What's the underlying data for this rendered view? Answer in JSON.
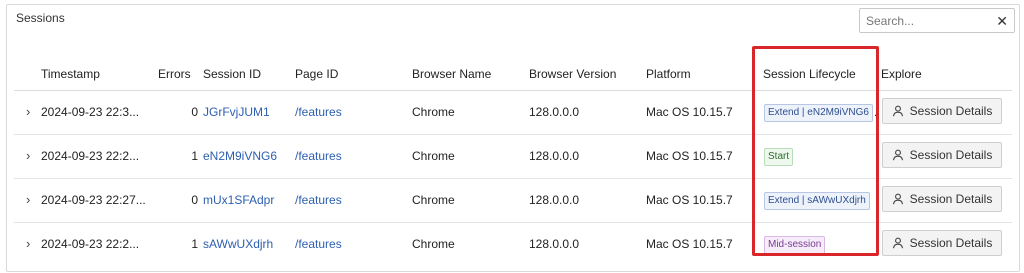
{
  "panel": {
    "title": "Sessions"
  },
  "search": {
    "placeholder": "Search...",
    "clear": "✕"
  },
  "columns": {
    "timestamp": "Timestamp",
    "errors": "Errors",
    "session_id": "Session ID",
    "page_id": "Page ID",
    "browser_name": "Browser Name",
    "browser_version": "Browser Version",
    "platform": "Platform",
    "session_lifecycle": "Session Lifecycle",
    "explore": "Explore"
  },
  "rows": [
    {
      "expand": "›",
      "timestamp": "2024-09-23 22:3...",
      "errors": "0",
      "session_id": "JGrFvjJUM1",
      "page_id": "/features",
      "browser_name": "Chrome",
      "browser_version": "128.0.0.0",
      "platform": "Mac OS 10.15.7",
      "lifecycle": "Extend | eN2M9iVNG6",
      "lifecycle_suffix": ".",
      "lifecycle_color": "blue",
      "explore": "Session Details"
    },
    {
      "expand": "›",
      "timestamp": "2024-09-23 22:2...",
      "errors": "1",
      "session_id": "eN2M9iVNG6",
      "page_id": "/features",
      "browser_name": "Chrome",
      "browser_version": "128.0.0.0",
      "platform": "Mac OS 10.15.7",
      "lifecycle": "Start",
      "lifecycle_suffix": "",
      "lifecycle_color": "green",
      "explore": "Session Details"
    },
    {
      "expand": "›",
      "timestamp": "2024-09-23 22:27...",
      "errors": "0",
      "session_id": "mUx1SFAdpr",
      "page_id": "/features",
      "browser_name": "Chrome",
      "browser_version": "128.0.0.0",
      "platform": "Mac OS 10.15.7",
      "lifecycle": "Extend | sAWwUXdjrh",
      "lifecycle_suffix": "",
      "lifecycle_color": "blue",
      "explore": "Session Details"
    },
    {
      "expand": "›",
      "timestamp": "2024-09-23 22:2...",
      "errors": "1",
      "session_id": "sAWwUXdjrh",
      "page_id": "/features",
      "browser_name": "Chrome",
      "browser_version": "128.0.0.0",
      "platform": "Mac OS 10.15.7",
      "lifecycle": "Mid-session",
      "lifecycle_suffix": "",
      "lifecycle_color": "purple",
      "explore": "Session Details"
    }
  ],
  "icons": {
    "explore_button": "person-icon",
    "expand": "chevron-right-icon",
    "clear": "close-icon"
  },
  "colors": {
    "highlight": "#d9262b",
    "link": "#2d5fb0"
  }
}
